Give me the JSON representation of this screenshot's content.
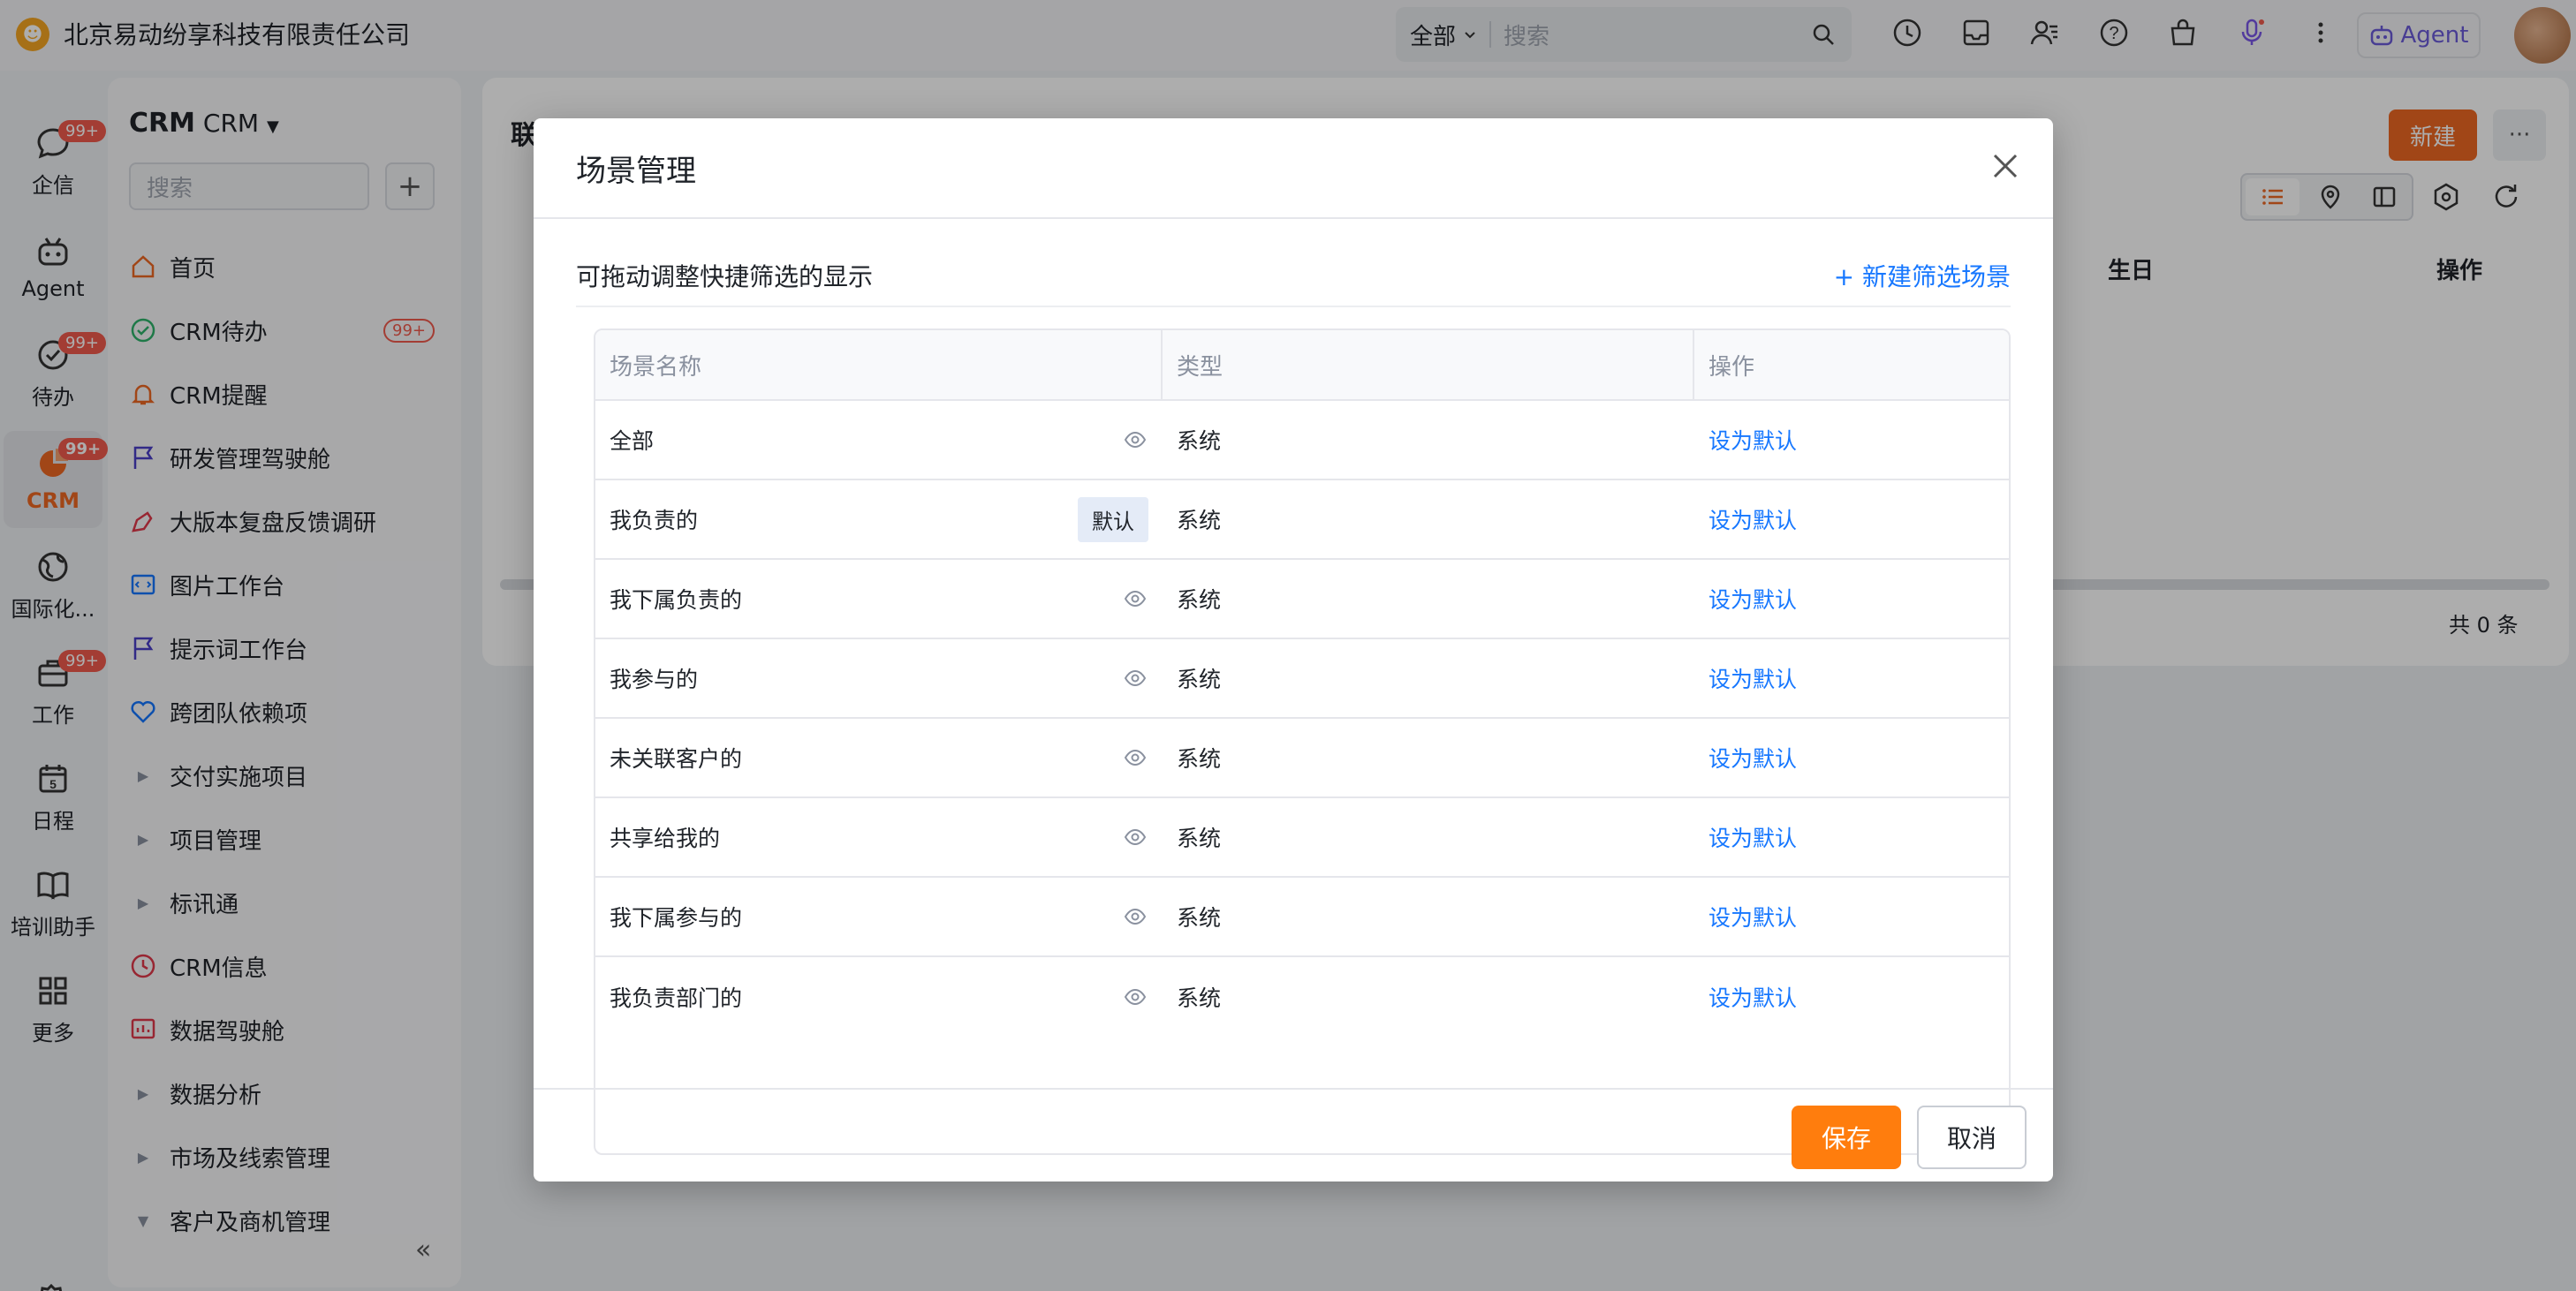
{
  "header": {
    "company": "北京易动纷享科技有限责任公司",
    "search_scope": "全部",
    "search_placeholder": "搜索",
    "agent_label": "Agent"
  },
  "rail": {
    "items": [
      {
        "label": "企信",
        "badge": "99+"
      },
      {
        "label": "Agent",
        "badge": ""
      },
      {
        "label": "待办",
        "badge": "99+"
      },
      {
        "label": "CRM",
        "badge": "99+"
      },
      {
        "label": "国际化...",
        "badge": ""
      },
      {
        "label": "工作",
        "badge": "99+"
      },
      {
        "label": "日程",
        "badge": ""
      },
      {
        "label": "培训助手",
        "badge": ""
      },
      {
        "label": "更多",
        "badge": ""
      }
    ],
    "calendar_day": "5"
  },
  "nav": {
    "title_bold": "CRM",
    "title_sub": "CRM",
    "search_placeholder": "搜索",
    "items": [
      {
        "label": "首页"
      },
      {
        "label": "CRM待办",
        "badge": "99+"
      },
      {
        "label": "CRM提醒"
      },
      {
        "label": "研发管理驾驶舱"
      },
      {
        "label": "大版本复盘反馈调研"
      },
      {
        "label": "图片工作台"
      },
      {
        "label": "提示词工作台"
      },
      {
        "label": "跨团队依赖项"
      },
      {
        "label": "交付实施项目"
      },
      {
        "label": "项目管理"
      },
      {
        "label": "标讯通"
      },
      {
        "label": "CRM信息"
      },
      {
        "label": "数据驾驶舱"
      },
      {
        "label": "数据分析"
      },
      {
        "label": "市场及线索管理"
      },
      {
        "label": "客户及商机管理"
      }
    ]
  },
  "main": {
    "title": "联",
    "new_label": "新建",
    "col_birthday": "生日",
    "col_ops": "操作",
    "total": "共 0 条"
  },
  "dialog": {
    "title": "场景管理",
    "hint": "可拖动调整快捷筛选的显示",
    "new_scene": "+ 新建筛选场景",
    "columns": [
      "场景名称",
      "类型",
      "操作"
    ],
    "rows": [
      {
        "name": "全部",
        "type": "系统",
        "action": "设为默认",
        "is_default": false
      },
      {
        "name": "我负责的",
        "type": "系统",
        "action": "设为默认",
        "is_default": true,
        "tag": "默认"
      },
      {
        "name": "我下属负责的",
        "type": "系统",
        "action": "设为默认",
        "is_default": false
      },
      {
        "name": "我参与的",
        "type": "系统",
        "action": "设为默认",
        "is_default": false
      },
      {
        "name": "未关联客户的",
        "type": "系统",
        "action": "设为默认",
        "is_default": false
      },
      {
        "name": "共享给我的",
        "type": "系统",
        "action": "设为默认",
        "is_default": false
      },
      {
        "name": "我下属参与的",
        "type": "系统",
        "action": "设为默认",
        "is_default": false
      },
      {
        "name": "我负责部门的",
        "type": "系统",
        "action": "设为默认",
        "is_default": false
      }
    ],
    "save_label": "保存",
    "cancel_label": "取消"
  },
  "colors": {
    "accent_orange": "#ff7d0d",
    "link_blue": "#1677ff",
    "badge_red": "#f05b4d"
  }
}
